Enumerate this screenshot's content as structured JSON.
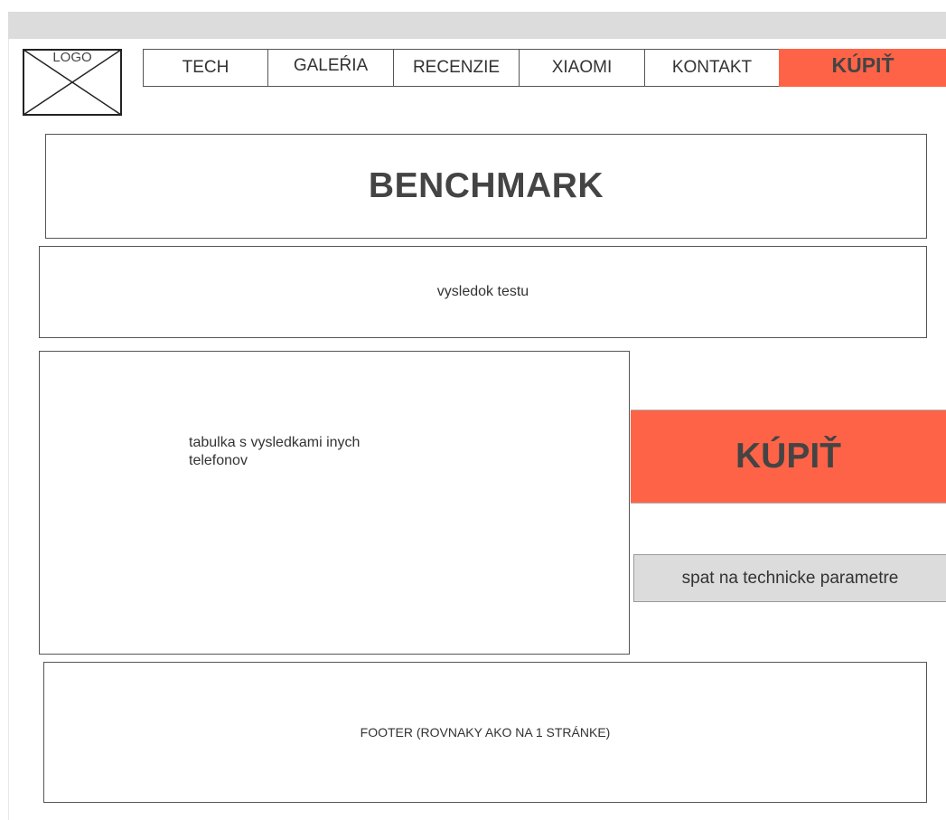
{
  "header": {
    "logo_label": "LOGO"
  },
  "nav": {
    "items": [
      {
        "label": "TECH"
      },
      {
        "label": "GALEŔIA"
      },
      {
        "label": "RECENZIE"
      },
      {
        "label": "XIAOMI"
      },
      {
        "label": "KONTAKT"
      }
    ],
    "buy_label": "KÚPIŤ"
  },
  "main": {
    "title": "BENCHMARK",
    "result_text": "vysledok testu",
    "table_text": "tabulka s vysledkami inych telefonov",
    "buy_label": "KÚPIŤ",
    "back_label": "spat na technicke parametre"
  },
  "footer": {
    "text": "FOOTER (ROVNAKY AKO NA 1 STRÁNKE)"
  },
  "colors": {
    "accent": "#ff6347",
    "topbar": "#dcdcdc",
    "secondary_button": "#dcdcdc"
  }
}
